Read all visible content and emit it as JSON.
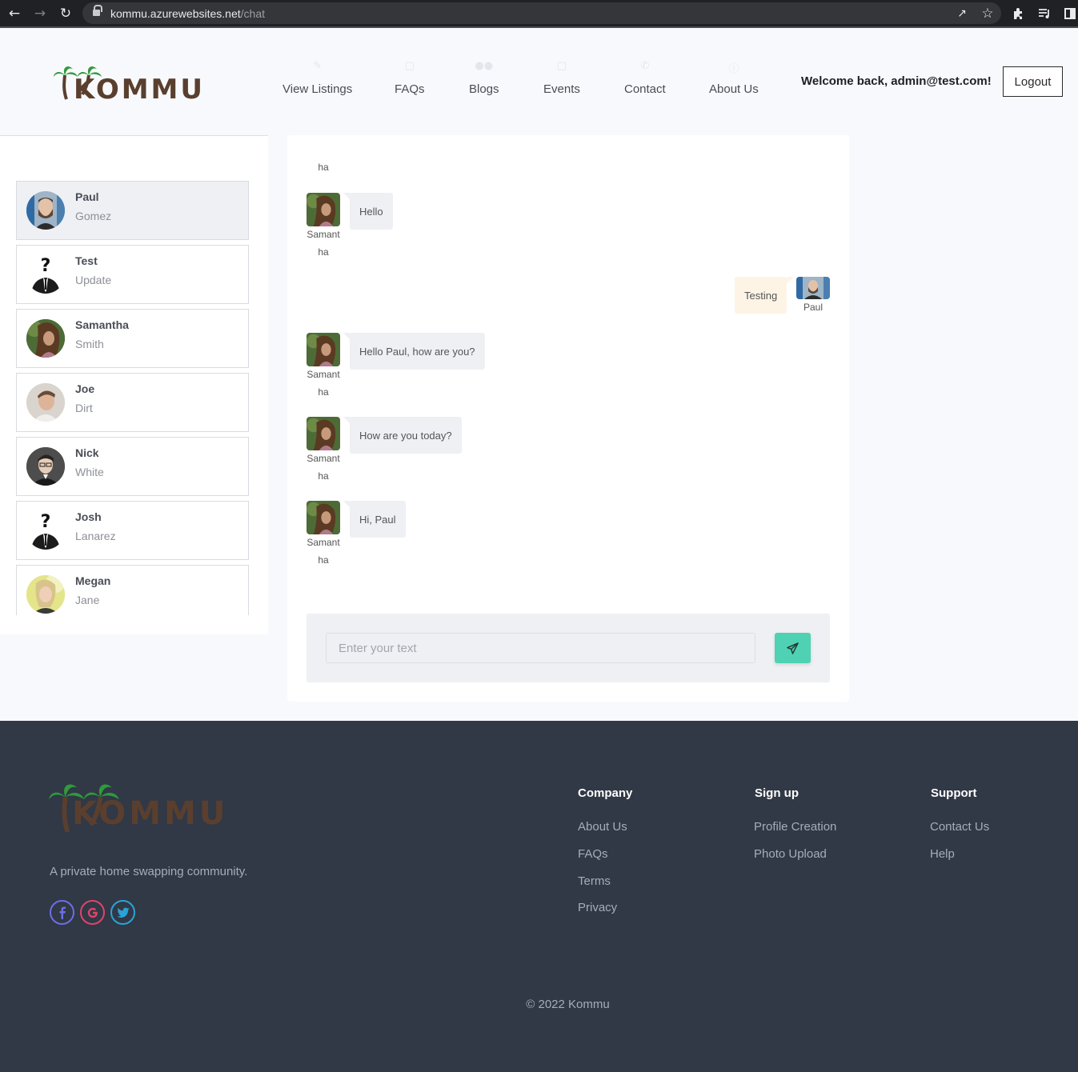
{
  "browser": {
    "url_host": "kommu.azurewebsites.net",
    "url_path": "/chat"
  },
  "header": {
    "logo_text": "KOMMU",
    "nav": [
      "View Listings",
      "FAQs",
      "Blogs",
      "Events",
      "Contact",
      "About Us"
    ],
    "welcome": "Welcome back, admin@test.com!",
    "logout_label": "Logout"
  },
  "contacts": [
    {
      "first": "Paul",
      "last": "Gomez",
      "avatar": "photo",
      "active": true
    },
    {
      "first": "Test",
      "last": "Update",
      "avatar": "placeholder-silhouette"
    },
    {
      "first": "Samantha",
      "last": "Smith",
      "avatar": "photo"
    },
    {
      "first": "Joe",
      "last": "Dirt",
      "avatar": "photo"
    },
    {
      "first": "Nick",
      "last": "White",
      "avatar": "photo"
    },
    {
      "first": "Josh",
      "last": "Lanarez",
      "avatar": "placeholder-silhouette"
    },
    {
      "first": "Megan",
      "last": "Jane",
      "avatar": "photo"
    }
  ],
  "chat": {
    "top_fragment": "ha",
    "messages": [
      {
        "sender_line1": "Samant",
        "sender_line2": "ha",
        "text": "Hello",
        "direction": "incoming"
      },
      {
        "sender_line1": "Paul",
        "text": "Testing",
        "direction": "outgoing"
      },
      {
        "sender_line1": "Samant",
        "sender_line2": "ha",
        "text": "Hello Paul, how are you?",
        "direction": "incoming"
      },
      {
        "sender_line1": "Samant",
        "sender_line2": "ha",
        "text": "How are you today?",
        "direction": "incoming"
      },
      {
        "sender_line1": "Samant",
        "sender_line2": "ha",
        "text": "Hi, Paul",
        "direction": "incoming"
      }
    ],
    "input_placeholder": "Enter your text",
    "send_icon": "paper-plane-icon"
  },
  "footer": {
    "logo_text": "KOMMU",
    "tagline": "A private home swapping community.",
    "social": [
      "facebook-icon",
      "google-icon",
      "twitter-icon"
    ],
    "columns": [
      {
        "heading": "Company",
        "links": [
          "About Us",
          "FAQs",
          "Terms",
          "Privacy"
        ]
      },
      {
        "heading": "Sign up",
        "links": [
          "Profile Creation",
          "Photo Upload"
        ]
      },
      {
        "heading": "Support",
        "links": [
          "Contact Us",
          "Help"
        ]
      }
    ],
    "copyright": "© 2022 Kommu"
  },
  "colors": {
    "accent": "#4fd1b3",
    "footer_bg": "#313846",
    "logo_brown": "#5a3f2e",
    "palm_green": "#2f9a3c",
    "facebook": "#6c6ee6",
    "google": "#e0436b",
    "twitter": "#2aa3d6"
  }
}
